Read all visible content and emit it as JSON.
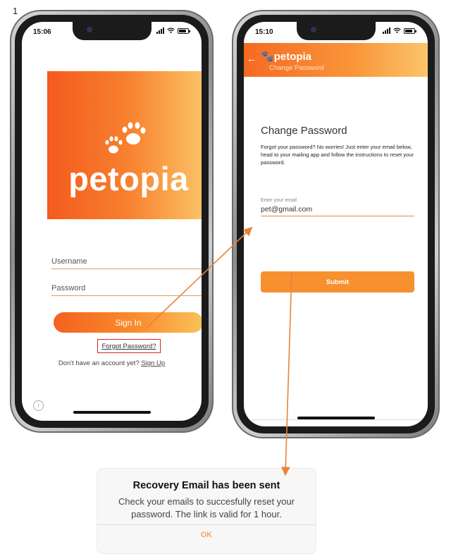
{
  "step_number": "1",
  "colors": {
    "accent": "#f7902f",
    "arrow": "#e8833a",
    "highlight_border": "#dd2222"
  },
  "login_screen": {
    "status_time": "15:06",
    "logo_text": "petopia",
    "username_placeholder": "Username",
    "password_placeholder": "Password",
    "sign_in_label": "Sign In",
    "forgot_password_link": "Forgot Password?",
    "no_account_text": "Don't have an account yet?",
    "sign_up_link": "Sign Up"
  },
  "change_password_screen": {
    "status_time": "15:10",
    "app_bar_logo": "petopia",
    "app_bar_subtitle": "Change Password",
    "title": "Change Password",
    "description": "Forgot your password? No worries! Just enter your email below, head to your mailing app and follow the instructions to reset your password.",
    "email_label": "Enter your email",
    "email_value": "pet@gmail.com",
    "submit_label": "Submit"
  },
  "dialog": {
    "title": "Recovery Email has been sent",
    "message": "Check your emails to succesfully reset your password. The link is valid for 1 hour.",
    "ok_label": "OK"
  }
}
